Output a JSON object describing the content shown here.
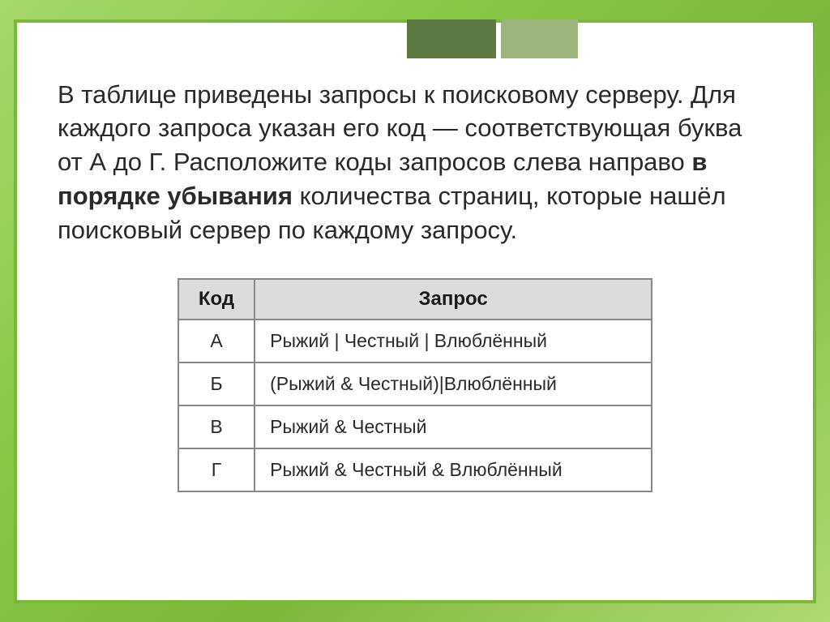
{
  "task": {
    "text_part1": "В таблице приведены запросы к поисковому серверу. Для каждого запроса указан его код — соответствующая буква от А до Г. Расположите коды запросов слева направо ",
    "bold_part": "в порядке убывания",
    "text_part2": " количества страниц, которые нашёл поисковый сервер по каждому запросу."
  },
  "table": {
    "headers": {
      "code": "Код",
      "query": "Запрос"
    },
    "rows": [
      {
        "code": "А",
        "query": "Рыжий | Честный | Влюблённый"
      },
      {
        "code": "Б",
        "query": "(Рыжий & Честный)|Влюблённый"
      },
      {
        "code": "В",
        "query": "Рыжий & Честный"
      },
      {
        "code": "Г",
        "query": "Рыжий & Честный & Влюблённый"
      }
    ]
  }
}
